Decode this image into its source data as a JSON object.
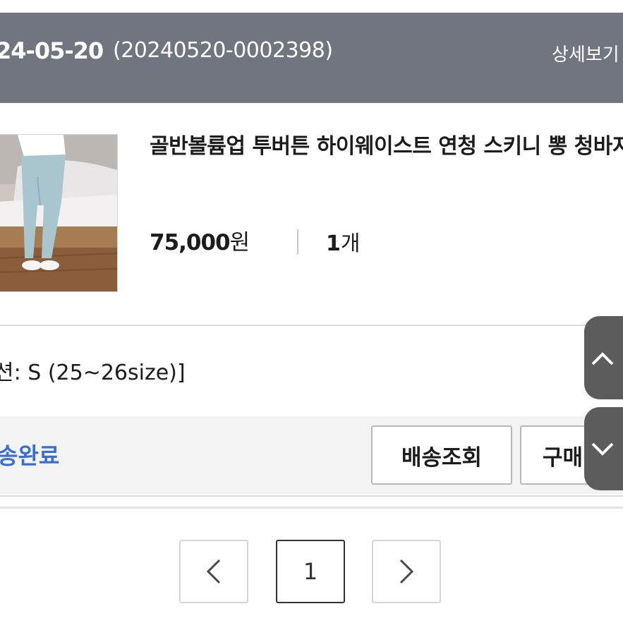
{
  "header": {
    "order_date": "24-05-20",
    "order_number": "(20240520-0002398)",
    "detail_link": "상세보기"
  },
  "product": {
    "name": "골반볼륨업 투버튼 하이웨이스트 연청 스키니 뽕 청바지",
    "price": "75,000",
    "price_unit": "원",
    "quantity": "1",
    "quantity_unit": "개",
    "option": "션: S (25~26size)]"
  },
  "status": {
    "label": "송완료"
  },
  "buttons": {
    "shipping_lookup": "배송조회",
    "purchase": "구매"
  },
  "pagination": {
    "current_page": "1"
  },
  "colors": {
    "header_bg": "#707580",
    "status_blue": "#3a6fd1",
    "fab_bg": "#5c5c5c"
  },
  "icons": {
    "prev": "chevron-left-icon",
    "next": "chevron-right-icon",
    "scroll_up": "chevron-up-icon",
    "scroll_down": "chevron-down-icon"
  }
}
